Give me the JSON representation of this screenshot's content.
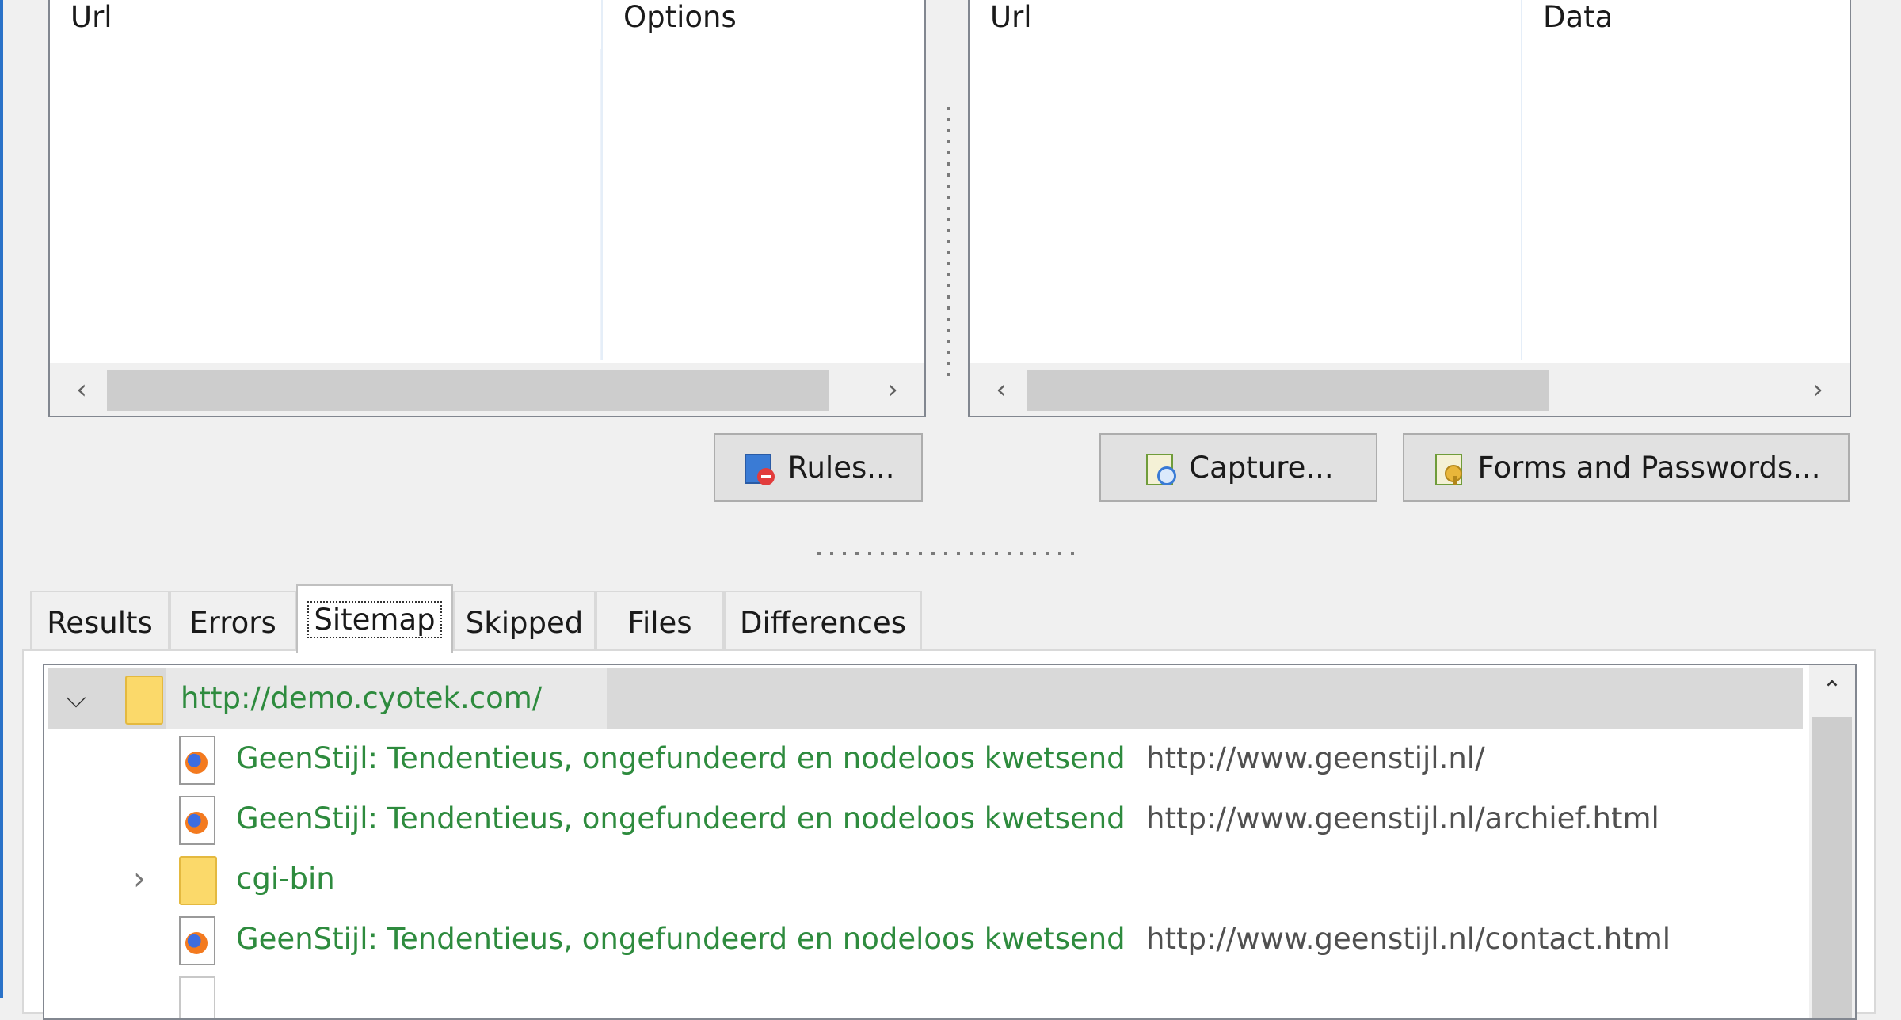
{
  "rules_panel": {
    "columns": [
      "Url",
      "Options"
    ]
  },
  "capture_panel": {
    "columns": [
      "Url",
      "Data"
    ]
  },
  "buttons": {
    "rules": "Rules...",
    "capture": "Capture...",
    "forms": "Forms and Passwords..."
  },
  "tabs": [
    "Results",
    "Errors",
    "Sitemap",
    "Skipped",
    "Files",
    "Differences"
  ],
  "active_tab": "Sitemap",
  "sitemap": {
    "root": "http://demo.cyotek.com/",
    "rows": [
      {
        "title": "GeenStijl: Tendentieus, ongefundeerd en nodeloos kwetsend",
        "url": "http://www.geenstijl.nl/"
      },
      {
        "title": "GeenStijl: Tendentieus, ongefundeerd en nodeloos kwetsend",
        "url": "http://www.geenstijl.nl/archief.html"
      },
      {
        "folder": "cgi-bin"
      },
      {
        "title": "GeenStijl: Tendentieus, ongefundeerd en nodeloos kwetsend",
        "url": "http://www.geenstijl.nl/contact.html"
      }
    ]
  },
  "colors": {
    "link_green": "#2e8b3e",
    "selection": "#d9d9d9",
    "accent": "#2b72c8"
  }
}
